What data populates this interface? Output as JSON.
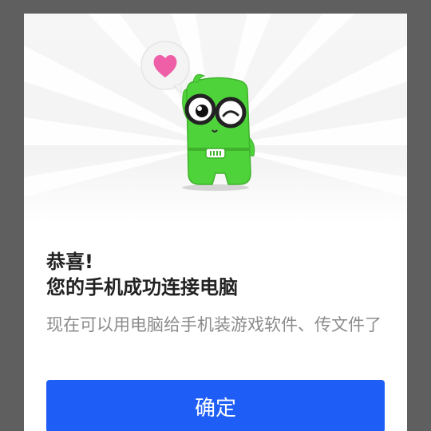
{
  "dialog": {
    "title_line1": "恭喜!",
    "title_line2": "您的手机成功连接电脑",
    "description": "现在可以用电脑给手机装游戏软件、传文件了",
    "confirm_label": "确定"
  },
  "illustration": {
    "mascot": "green-robot-mascot",
    "bubble_icon": "heart-icon"
  },
  "colors": {
    "overlay": "#5f5f5f",
    "accent": "#1f5ef6",
    "mascot_green": "#4fd33b",
    "heart": "#ee5fa8"
  }
}
